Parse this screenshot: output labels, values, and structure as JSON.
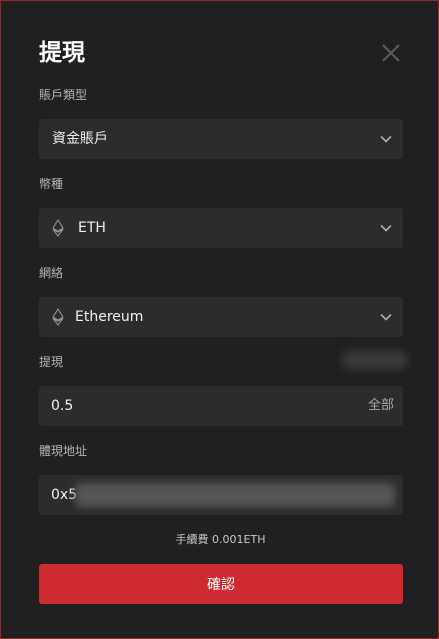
{
  "modal": {
    "title": "提現",
    "close_icon": "close-icon"
  },
  "account_type": {
    "label": "賬戶類型",
    "value": "資金賬戶"
  },
  "currency": {
    "label": "幣種",
    "value": "ETH",
    "icon": "ethereum-icon"
  },
  "network": {
    "label": "網絡",
    "value": "Ethereum",
    "icon": "ethereum-icon"
  },
  "amount": {
    "label": "提現",
    "value": "0.5",
    "all_label": "全部"
  },
  "address": {
    "label": "體現地址",
    "value": "0x5"
  },
  "fee_text": "手續費 0.001ETH",
  "confirm_label": "確認",
  "colors": {
    "background": "#202020",
    "field": "#2c2c2c",
    "accent": "#cf2a30",
    "border": "#8a2a2a"
  }
}
